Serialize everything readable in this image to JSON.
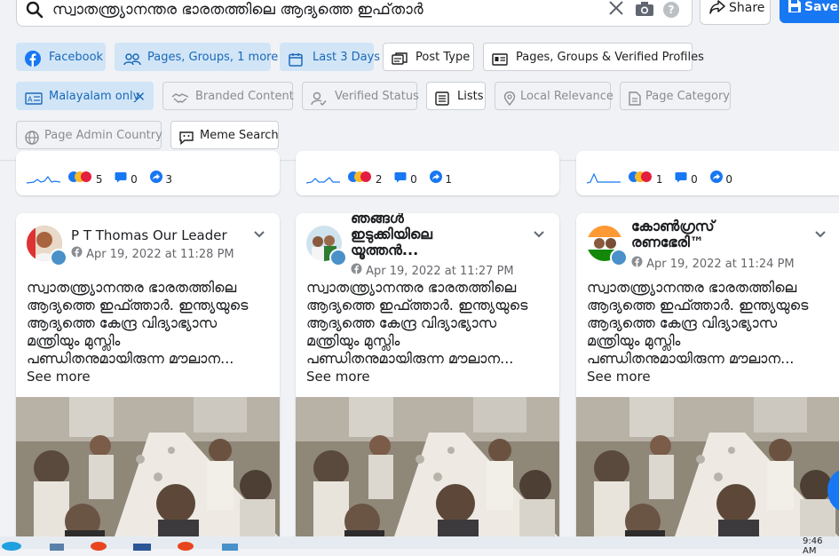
{
  "search": {
    "query": "സ്വാതന്ത്ര്യാനന്തര ഭാരതത്തിലെ ആദ്യത്തെ ഇഫ്‌താർ",
    "share_label": "Share",
    "save_label": "Save"
  },
  "filters": {
    "row1": [
      {
        "label": "Facebook",
        "icon": "facebook-icon",
        "state": "active"
      },
      {
        "label": "Pages, Groups, 1 more",
        "icon": "groups-icon",
        "state": "active"
      },
      {
        "label": "Last 3 Days",
        "icon": "calendar-icon",
        "state": "active"
      },
      {
        "label": "Post Type",
        "icon": "post-type-icon",
        "state": "normal"
      },
      {
        "label": "Pages, Groups & Verified Profiles",
        "icon": "profiles-icon",
        "state": "normal"
      }
    ],
    "row2": [
      {
        "label": "Malayalam only",
        "icon": "language-icon",
        "state": "active"
      },
      {
        "label": "Branded Content",
        "icon": "handshake-icon",
        "state": "disabled"
      },
      {
        "label": "Verified Status",
        "icon": "verified-user-icon",
        "state": "disabled"
      },
      {
        "label": "Lists",
        "icon": "list-icon",
        "state": "normal"
      },
      {
        "label": "Local Relevance",
        "icon": "location-icon",
        "state": "disabled"
      },
      {
        "label": "Page Category",
        "icon": "page-icon",
        "state": "disabled"
      }
    ],
    "row3": [
      {
        "label": "Page Admin Country",
        "icon": "globe-icon",
        "state": "disabled"
      },
      {
        "label": "Meme Search",
        "icon": "meme-icon",
        "state": "normal"
      }
    ]
  },
  "top_cards": [
    {
      "reactions": "5",
      "comments": "0",
      "shares": "3"
    },
    {
      "reactions": "2",
      "comments": "0",
      "shares": "1"
    },
    {
      "reactions": "1",
      "comments": "0",
      "shares": "0"
    }
  ],
  "posts": [
    {
      "name": "P T Thomas Our Leader",
      "date": "Apr 19, 2022 at 11:28 PM",
      "text": [
        "സ്വാതന്ത്ര്യാനന്തര ഭാരതത്തിലെ",
        "ആദ്യത്തെ ഇഫ്ത്താർ. ഇന്ത്യയുടെ",
        "ആദ്യത്തെ കേന്ദ്ര വിദ്യാഭ്യാസ",
        "മന്ത്രിയും മുസ്ലിം",
        "പണ്ഡിതനുമായിരുന്ന മൗലാന..."
      ],
      "see_more": "See more"
    },
    {
      "name_lines": [
        "ഞങ്ങൾ",
        "ഇടുക്കിയിലെ",
        "യൂത്തൻ..."
      ],
      "date": "Apr 19, 2022 at 11:27 PM",
      "text": [
        "സ്വാതന്ത്ര്യാനന്തര ഭാരതത്തിലെ",
        "ആദ്യത്തെ ഇഫ്ത്താർ. ഇന്ത്യയുടെ",
        "ആദ്യത്തെ കേന്ദ്ര വിദ്യാഭ്യാസ",
        "മന്ത്രിയും മുസ്ലിം",
        "പണ്ഡിതനുമായിരുന്ന മൗലാന..."
      ],
      "see_more": "See more"
    },
    {
      "name_lines": [
        "കോൺഗ്രസ്",
        "രണഭേരി™"
      ],
      "date": "Apr 19, 2022 at 11:24 PM",
      "text": [
        "സ്വാതന്ത്ര്യാനന്തര ഭാരതത്തിലെ",
        "ആദ്യത്തെ ഇഫ്ത്താർ. ഇന്ത്യയുടെ",
        "ആദ്യത്തെ കേന്ദ്ര വിദ്യാഭ്യാസ",
        "മന്ത്രിയും മുസ്ലിം",
        "പണ്ഡിതനുമായിരുന്ന മൗലാന..."
      ],
      "see_more": "See more"
    }
  ],
  "taskbar": {
    "time": "9:46 AM"
  },
  "colors": {
    "accent": "#1877f2",
    "chip_active_bg": "#d1e5f7",
    "chip_active_text": "#1a69b8"
  }
}
